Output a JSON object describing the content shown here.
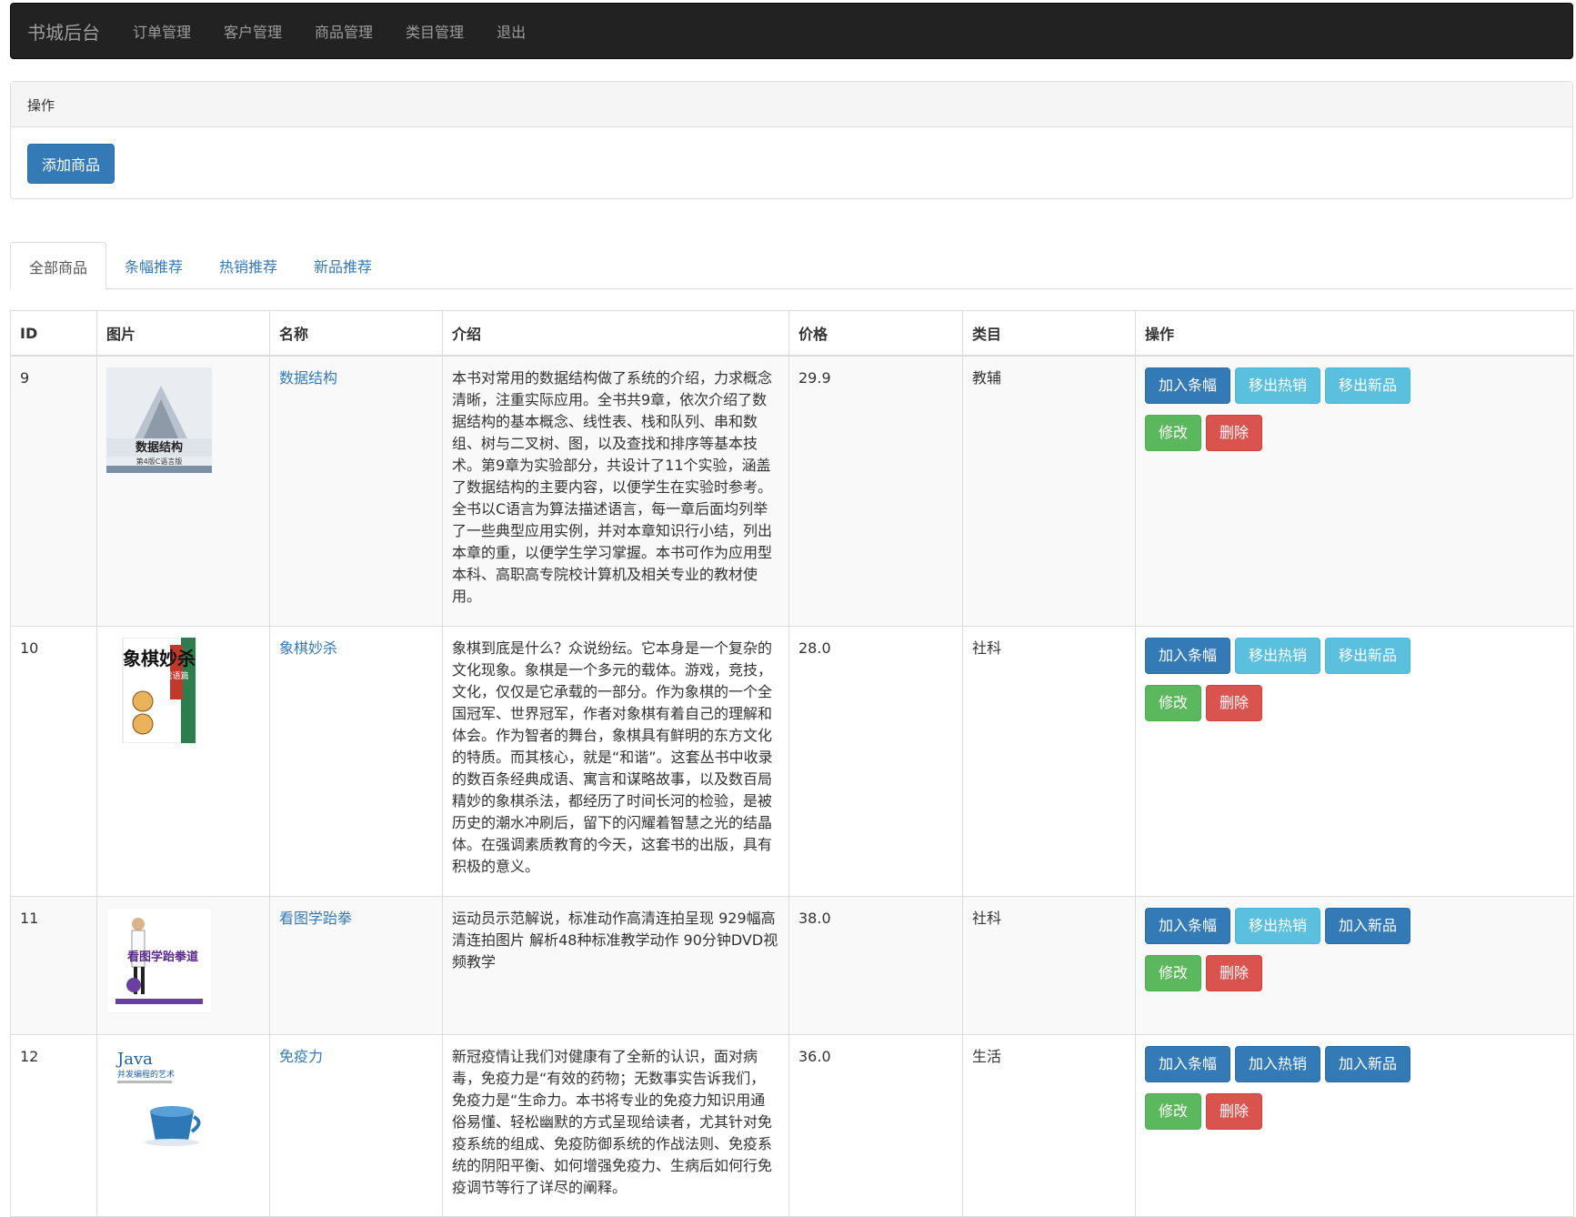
{
  "navbar": {
    "brand": "书城后台",
    "links": [
      "订单管理",
      "客户管理",
      "商品管理",
      "类目管理",
      "退出"
    ]
  },
  "panel": {
    "heading": "操作",
    "add_button": "添加商品"
  },
  "tabs": [
    {
      "label": "全部商品",
      "active": true
    },
    {
      "label": "条幅推荐",
      "active": false
    },
    {
      "label": "热销推荐",
      "active": false
    },
    {
      "label": "新品推荐",
      "active": false
    }
  ],
  "table": {
    "headers": [
      "ID",
      "图片",
      "名称",
      "介绍",
      "价格",
      "类目",
      "操作"
    ],
    "rows": [
      {
        "id": "9",
        "cover_title": "数据结构",
        "cover_subtitle": "第4版C语言版",
        "name": "数据结构",
        "intro": "本书对常用的数据结构做了系统的介绍，力求概念清晰，注重实际应用。全书共9章，依次介绍了数据结构的基本概念、线性表、栈和队列、串和数组、树与二叉树、图，以及查找和排序等基本技术。第9章为实验部分，共设计了11个实验，涵盖了数据结构的主要内容，以便学生在实验时参考。全书以C语言为算法描述语言，每一章后面均列举了一些典型应用实例，并对本章知识行小结，列出本章的重，以便学生学习掌握。本书可作为应用型本科、高职高专院校计算机及相关专业的教材使用。",
        "price": "29.9",
        "category": "教辅",
        "ops": [
          {
            "label": "加入条幅",
            "style": "primary"
          },
          {
            "label": "移出热销",
            "style": "info"
          },
          {
            "label": "移出新品",
            "style": "info"
          },
          {
            "label": "修改",
            "style": "success"
          },
          {
            "label": "删除",
            "style": "danger"
          }
        ]
      },
      {
        "id": "10",
        "cover_title": "象棋妙杀",
        "cover_subtitle": "成语篇",
        "name": "象棋妙杀",
        "intro": "象棋到底是什么？众说纷纭。它本身是一个复杂的文化现象。象棋是一个多元的载体。游戏，竞技，文化，仅仅是它承载的一部分。作为象棋的一个全国冠军、世界冠军，作者对象棋有着自己的理解和体会。作为智者的舞台，象棋具有鲜明的东方文化的特质。而其核心，就是“和谐”。这套丛书中收录的数百条经典成语、寓言和谋略故事，以及数百局精妙的象棋杀法，都经历了时间长河的检验，是被历史的潮水冲刷后，留下的闪耀着智慧之光的结晶体。在强调素质教育的今天，这套书的出版，具有积极的意义。",
        "price": "28.0",
        "category": "社科",
        "ops": [
          {
            "label": "加入条幅",
            "style": "primary"
          },
          {
            "label": "移出热销",
            "style": "info"
          },
          {
            "label": "移出新品",
            "style": "info"
          },
          {
            "label": "修改",
            "style": "success"
          },
          {
            "label": "删除",
            "style": "danger"
          }
        ]
      },
      {
        "id": "11",
        "cover_title": "看图学跆拳道",
        "cover_subtitle": "",
        "name": "看图学跆拳",
        "intro": "运动员示范解说，标准动作高清连拍呈现 929幅高清连拍图片 解析48种标准教学动作 90分钟DVD视频教学",
        "price": "38.0",
        "category": "社科",
        "ops": [
          {
            "label": "加入条幅",
            "style": "primary"
          },
          {
            "label": "移出热销",
            "style": "info"
          },
          {
            "label": "加入新品",
            "style": "primary"
          },
          {
            "label": "修改",
            "style": "success"
          },
          {
            "label": "删除",
            "style": "danger"
          }
        ]
      },
      {
        "id": "12",
        "cover_title": "Java",
        "cover_subtitle": "并发编程的艺术",
        "name": "免疫力",
        "intro": "新冠疫情让我们对健康有了全新的认识，面对病毒，免疫力是“有效的药物；无数事实告诉我们，免疫力是“生命力。本书将专业的免疫力知识用通俗易懂、轻松幽默的方式呈现给读者，尤其针对免疫系统的组成、免疫防御系统的作战法则、免疫系统的阴阳平衡、如何增强免疫力、生病后如何行免疫调节等行了详尽的阐释。",
        "price": "36.0",
        "category": "生活",
        "ops": [
          {
            "label": "加入条幅",
            "style": "primary"
          },
          {
            "label": "加入热销",
            "style": "primary"
          },
          {
            "label": "加入新品",
            "style": "primary"
          },
          {
            "label": "修改",
            "style": "success"
          },
          {
            "label": "删除",
            "style": "danger"
          }
        ]
      }
    ]
  },
  "colors": {
    "navbar_bg": "#222222",
    "primary": "#337ab7",
    "info": "#5bc0de",
    "success": "#5cb85c",
    "danger": "#d9534f"
  }
}
